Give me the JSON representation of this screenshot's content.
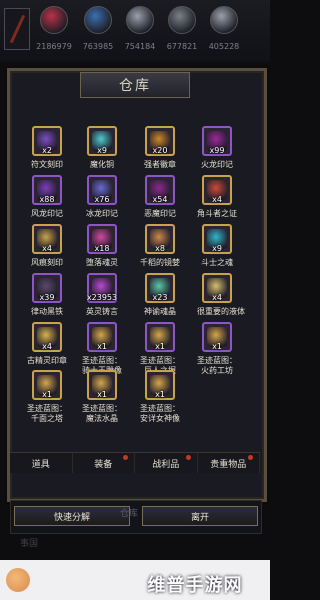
{
  "top": {
    "resources": [
      {
        "value": "2186979",
        "color": "#b8324a"
      },
      {
        "value": "763985",
        "color": "#3b6fb0"
      },
      {
        "value": "754184",
        "color": "#9aa0ad"
      },
      {
        "value": "677821",
        "color": "#7a8088"
      },
      {
        "value": "405228",
        "color": "#9aa0aa"
      }
    ]
  },
  "panel": {
    "title": "仓库"
  },
  "items": [
    {
      "label": "符文刻印",
      "qty": "x2",
      "color": "#7a4fc0",
      "frame": "gold"
    },
    {
      "label": "魔化铜",
      "qty": "x9",
      "color": "#4ecbcf",
      "frame": "gold"
    },
    {
      "label": "强者徽章",
      "qty": "x20",
      "color": "#c98a2a",
      "frame": "gold"
    },
    {
      "label": "火龙印记",
      "qty": "x99",
      "color": "#9a2a9a",
      "frame": "purple"
    },
    {
      "label": "风龙印记",
      "qty": "x88",
      "color": "#7a3fb8",
      "frame": "purple"
    },
    {
      "label": "冰龙印记",
      "qty": "x76",
      "color": "#6a6ad0",
      "frame": "purple"
    },
    {
      "label": "恶魔印记",
      "qty": "x54",
      "color": "#8a2a8a",
      "frame": "purple"
    },
    {
      "label": "角斗者之证",
      "qty": "x4",
      "color": "#c84a3a",
      "frame": "gold"
    },
    {
      "label": "风痕刻印",
      "qty": "x4",
      "color": "#c7a44a",
      "frame": "gold"
    },
    {
      "label": "堕落魂灵",
      "qty": "x18",
      "color": "#d24aa0",
      "frame": "purple"
    },
    {
      "label": "千稻的镜婪",
      "qty": "x8",
      "color": "#c98a4a",
      "frame": "gold"
    },
    {
      "label": "斗士之魂",
      "qty": "x9",
      "color": "#2fb8c8",
      "frame": "gold"
    },
    {
      "label": "律动黑铁",
      "qty": "x39",
      "color": "#5a4a6a",
      "frame": "purple"
    },
    {
      "label": "英灵铸言",
      "qty": "x23953",
      "color": "#b84ad0",
      "frame": "purple"
    },
    {
      "label": "神谕魂晶",
      "qty": "x23",
      "color": "#5ac8a8",
      "frame": "gold"
    },
    {
      "label": "很重要的液体",
      "qty": "x4",
      "color": "#d4c06a",
      "frame": "gold"
    },
    {
      "label": "古精灵印章",
      "qty": "x4",
      "color": "#d8b44a",
      "frame": "gold"
    },
    {
      "label": "圣迹蓝图：骑士王雕像",
      "qty": "x1",
      "color": "#d4a64a",
      "frame": "purple"
    },
    {
      "label": "圣迹蓝图：巨人之握",
      "qty": "x1",
      "color": "#d4a64a",
      "frame": "purple"
    },
    {
      "label": "圣迹蓝图：火药工坊",
      "qty": "x1",
      "color": "#d4a64a",
      "frame": "purple"
    },
    {
      "label": "圣迹蓝图：千面之塔",
      "qty": "x1",
      "color": "#d4a64a",
      "frame": "gold"
    },
    {
      "label": "圣迹蓝图：魔法水晶",
      "qty": "x1",
      "color": "#d4a64a",
      "frame": "gold"
    },
    {
      "label": "圣迹蓝图：安详女神像",
      "qty": "x1",
      "color": "#d4a64a",
      "frame": "gold"
    }
  ],
  "tabs": [
    {
      "label": "道具",
      "badge": false
    },
    {
      "label": "装备",
      "badge": true
    },
    {
      "label": "战利品",
      "badge": true
    },
    {
      "label": "贵重物品",
      "badge": true
    }
  ],
  "actions": {
    "quick_decompose": "快速分解",
    "leave": "离开",
    "ghost_text_1": "仓库",
    "ghost_text_2": "事国"
  },
  "watermark": "维普手游网"
}
